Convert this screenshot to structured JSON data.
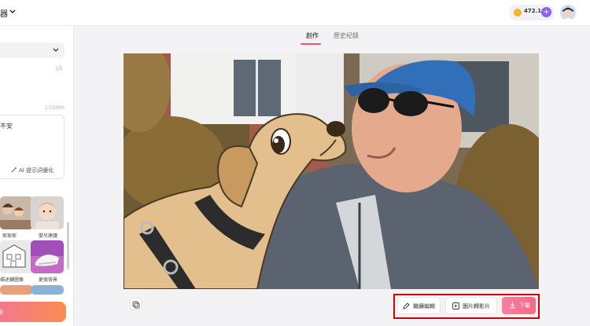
{
  "header": {
    "app_title": "器",
    "credits": "472.1",
    "plus": "+"
  },
  "sidebar": {
    "counter_a": "1/5",
    "counter_b": "17/5000",
    "prompt_text": "不安",
    "ai_optimize": "AI 提示詞優化",
    "tools": [
      {
        "label": "家家家"
      },
      {
        "label": "嬰兒建議"
      },
      {
        "label": "描述轉圖像"
      },
      {
        "label": "更換背景"
      }
    ]
  },
  "tabs": {
    "create": "創作",
    "history": "歷史紀錄"
  },
  "actions": {
    "edit": "繼續編輯",
    "to_video": "圖片轉影片",
    "download": "下載"
  },
  "colors": {
    "accent": "#ef5574",
    "download": "#f46a86",
    "highlight_frame": "#d30000"
  }
}
